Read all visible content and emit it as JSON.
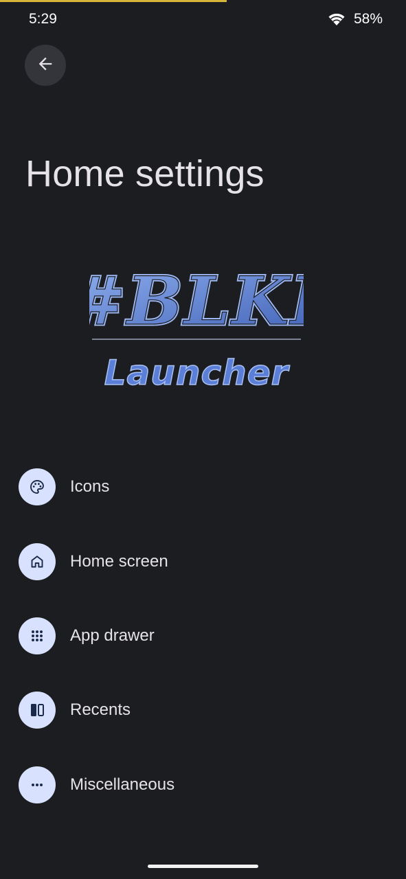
{
  "status_bar": {
    "time": "5:29",
    "battery": "58%",
    "wifi_icon": "wifi-icon"
  },
  "header": {
    "back_icon": "arrow-back-icon",
    "title": "Home settings"
  },
  "logo": {
    "line1": "#BLKI",
    "line2": "Launcher"
  },
  "menu": {
    "items": [
      {
        "label": "Icons",
        "icon": "palette-icon"
      },
      {
        "label": "Home screen",
        "icon": "home-icon"
      },
      {
        "label": "App drawer",
        "icon": "apps-grid-icon"
      },
      {
        "label": "Recents",
        "icon": "recents-icon"
      },
      {
        "label": "Miscellaneous",
        "icon": "more-horiz-icon"
      }
    ]
  },
  "colors": {
    "background": "#1c1d21",
    "icon_circle": "#d8e2ff",
    "icon_glyph": "#1b2a4a",
    "logo_stroke": "#5b7fd6",
    "accent_strip": "#d7b53a"
  }
}
